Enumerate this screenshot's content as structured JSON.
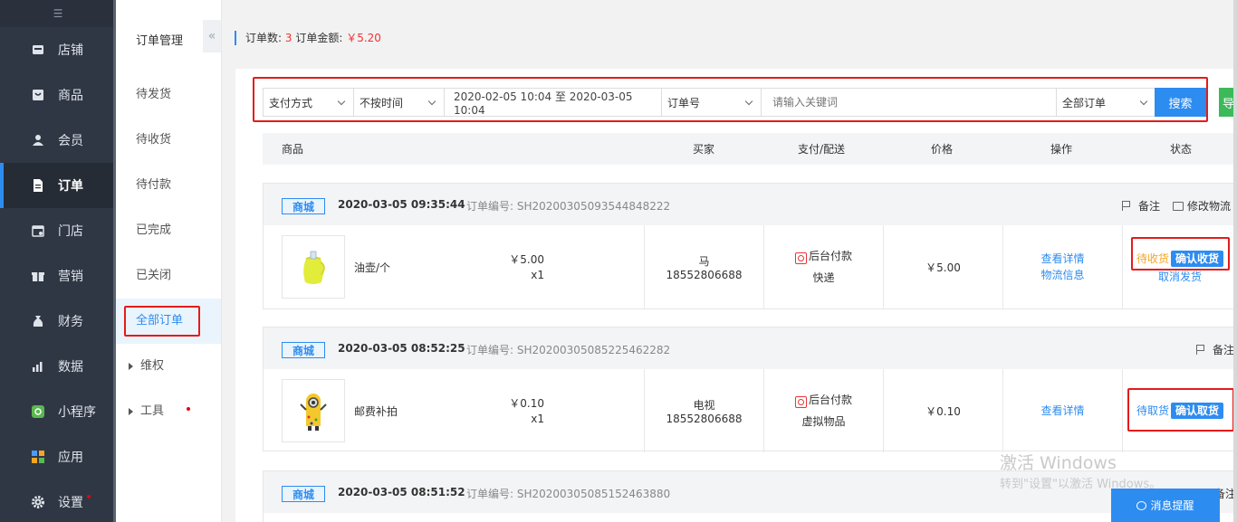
{
  "nav": {
    "items": [
      {
        "label": "店铺",
        "icon": "shop-icon"
      },
      {
        "label": "商品",
        "icon": "goods-icon"
      },
      {
        "label": "会员",
        "icon": "member-icon"
      },
      {
        "label": "订单",
        "icon": "order-icon"
      },
      {
        "label": "门店",
        "icon": "store-icon"
      },
      {
        "label": "营销",
        "icon": "gift-icon"
      },
      {
        "label": "财务",
        "icon": "money-bag-icon"
      },
      {
        "label": "数据",
        "icon": "chart-icon"
      },
      {
        "label": "小程序",
        "icon": "miniprogram-icon"
      },
      {
        "label": "应用",
        "icon": "apps-icon"
      },
      {
        "label": "设置",
        "icon": "gear-icon"
      }
    ],
    "collapse_glyph": "☰"
  },
  "subnav": {
    "title": "订单管理",
    "toggle_glyph": "«",
    "items": [
      "待发货",
      "待收货",
      "待付款",
      "已完成",
      "已关闭",
      "全部订单",
      "维权",
      "工具"
    ]
  },
  "summary": {
    "count_label": "订单数:",
    "count": "3",
    "amount_label": "订单金额:",
    "amount": "￥5.20"
  },
  "filter": {
    "pay_method": "支付方式",
    "time_type": "不按时间",
    "date_range": "2020-02-05 10:04 至 2020-03-05 10:04",
    "keyword_type": "订单号",
    "keyword_placeholder": "请输入关键词",
    "order_scope": "全部订单",
    "search_label": "搜索",
    "export_label": "导"
  },
  "table": {
    "headers": {
      "product": "商品",
      "buyer": "买家",
      "pay": "支付/配送",
      "price": "价格",
      "action": "操作",
      "status": "状态"
    }
  },
  "orders": [
    {
      "tag": "商城",
      "time": "2020-03-05  09:35:44",
      "order_no": "订单编号: SH20200305093544848222",
      "remark": "备注",
      "edit_logistics": "修改物流",
      "product_name": "油壶/个",
      "unit_price": "￥5.00",
      "qty": "x1",
      "buyer_name": "马",
      "buyer_phone": "18552806688",
      "pay_method": "后台付款",
      "delivery": "快递",
      "price": "￥5.00",
      "actions": [
        "查看详情",
        "物流信息"
      ],
      "status": "待收货",
      "confirm_label": "确认收货",
      "cancel_label": "取消发货"
    },
    {
      "tag": "商城",
      "time": "2020-03-05  08:52:25",
      "order_no": "订单编号: SH20200305085225462282",
      "remark": "备注",
      "product_name": "邮费补拍",
      "unit_price": "￥0.10",
      "qty": "x1",
      "buyer_name": "电视",
      "buyer_phone": "18552806688",
      "pay_method": "后台付款",
      "delivery": "虚拟物品",
      "price": "￥0.10",
      "actions": [
        "查看详情"
      ],
      "status": "待取货",
      "confirm_label": "确认取货"
    },
    {
      "tag": "商城",
      "time": "2020-03-05  08:51:52",
      "order_no": "订单编号: SH20200305085152463880",
      "remark": "备注"
    }
  ],
  "watermark": {
    "line1": "激活 Windows",
    "line2": "转到\"设置\"以激活 Windows。"
  },
  "message_button": "消息提醒"
}
